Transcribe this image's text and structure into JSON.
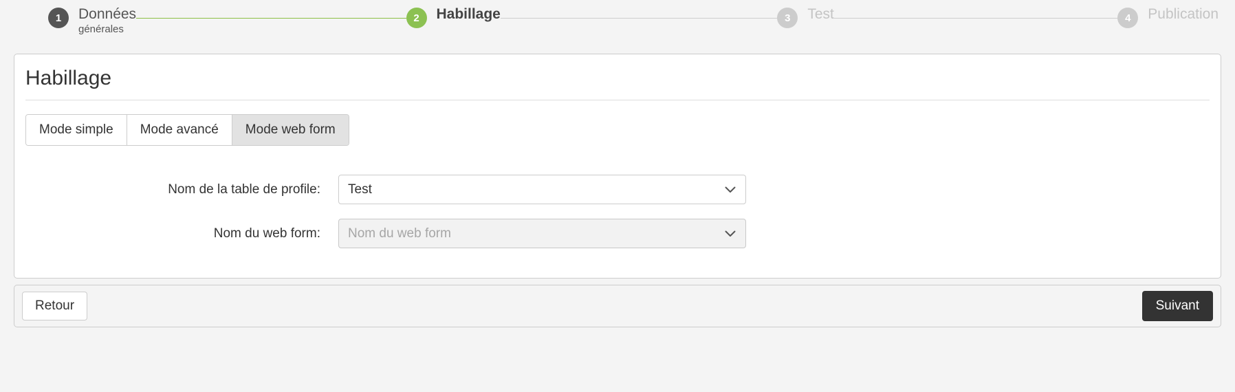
{
  "stepper": {
    "steps": [
      {
        "number": "1",
        "title": "Données",
        "subtitle": "générales",
        "state": "done"
      },
      {
        "number": "2",
        "title": "Habillage",
        "subtitle": "",
        "state": "active"
      },
      {
        "number": "3",
        "title": "Test",
        "subtitle": "",
        "state": "todo"
      },
      {
        "number": "4",
        "title": "Publication",
        "subtitle": "",
        "state": "todo"
      }
    ],
    "colors": {
      "done_circle": "#555555",
      "active_circle": "#8cc152",
      "todo_circle": "#cccccc",
      "completed_line": "#8cbf45",
      "pending_line": "#cfcfcf"
    }
  },
  "panel": {
    "title": "Habillage",
    "tabs": [
      {
        "label": "Mode simple",
        "selected": false
      },
      {
        "label": "Mode avancé",
        "selected": false
      },
      {
        "label": "Mode web form",
        "selected": true
      }
    ],
    "fields": [
      {
        "label": "Nom de la table de profile:",
        "value": "Test",
        "placeholder": "",
        "disabled": false,
        "icon": "chevron-down-icon"
      },
      {
        "label": "Nom du web form:",
        "value": "",
        "placeholder": "Nom du web form",
        "disabled": true,
        "icon": "chevron-down-icon"
      }
    ]
  },
  "footer": {
    "back_label": "Retour",
    "next_label": "Suivant",
    "next_bg": "#333333"
  }
}
